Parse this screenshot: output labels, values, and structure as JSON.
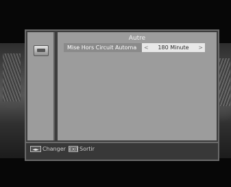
{
  "menu": {
    "title": "Autre",
    "setting": {
      "label": "Mise Hors Circuit Automa",
      "value": "180 Minute",
      "left_arrow": "<",
      "right_arrow": ">"
    }
  },
  "footer": {
    "change_key": "◄►",
    "change_label": "Changer",
    "exit_key": "EXIT",
    "exit_label": "Sortir"
  },
  "colors": {
    "panel": "#9c9c9c",
    "highlight_value": "#e8e8e8",
    "background": "#070707"
  },
  "icons": {
    "menu_icon": "settings-device-icon"
  }
}
